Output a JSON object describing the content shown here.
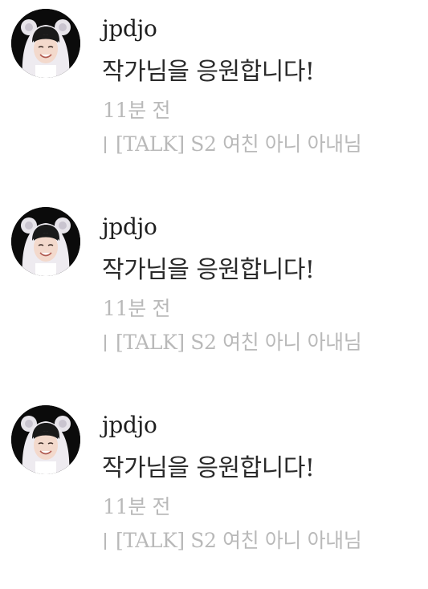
{
  "comments": [
    {
      "username": "jpdjo",
      "text": "작가님을 응원합니다!",
      "time": "11분 전",
      "source": "[TALK] S2 여친 아니 아내님",
      "avatar_icon": "profile-photo-icon"
    },
    {
      "username": "jpdjo",
      "text": "작가님을 응원합니다!",
      "time": "11분 전",
      "source": "[TALK] S2 여친 아니 아내님",
      "avatar_icon": "profile-photo-icon"
    },
    {
      "username": "jpdjo",
      "text": "작가님을 응원합니다!",
      "time": "11분 전",
      "source": "[TALK] S2 여친 아니 아내님",
      "avatar_icon": "profile-photo-icon"
    }
  ],
  "colors": {
    "username": "#1e1e1e",
    "text": "#2a2a2a",
    "meta": "#b9b9b9",
    "avatar_bg": "#0b0b0b"
  }
}
